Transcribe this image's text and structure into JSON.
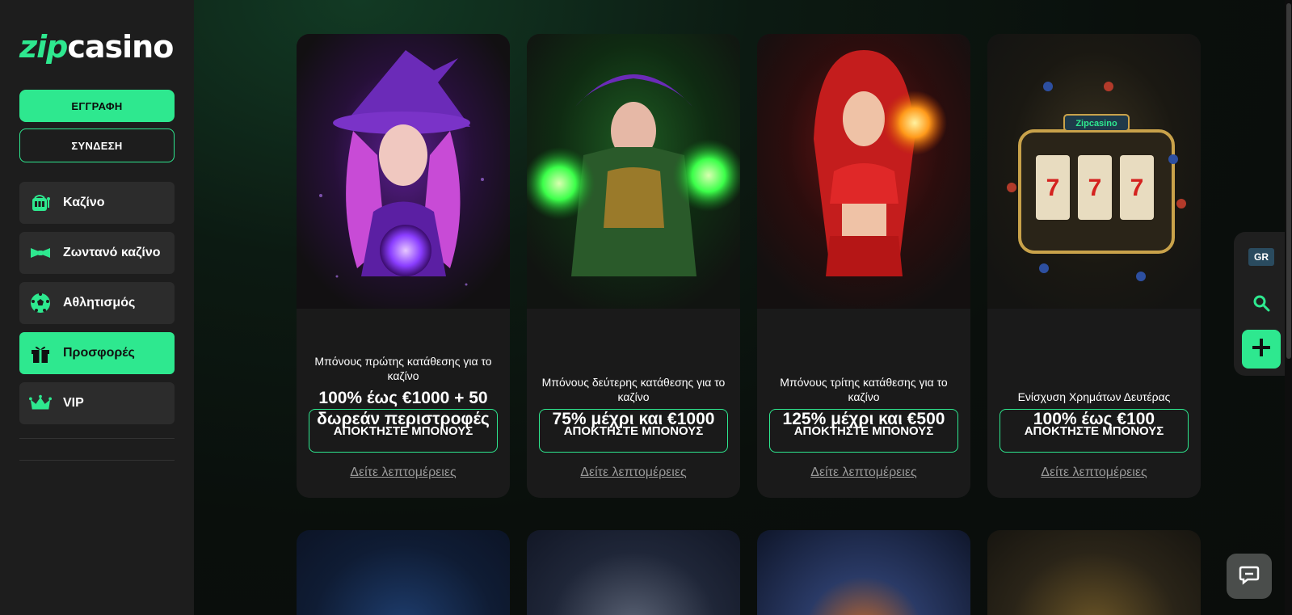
{
  "brand": {
    "part1": "zip",
    "part2": "casino",
    "accent": "#2ee88f"
  },
  "auth": {
    "register_label": "ΕΓΓΡΑΦΗ",
    "login_label": "ΣΥΝΔΕΣΗ"
  },
  "sidebar": {
    "items": [
      {
        "label": "Καζίνο",
        "icon": "slot-machine-icon",
        "active": false
      },
      {
        "label": "Ζωντανό καζίνο",
        "icon": "bowtie-icon",
        "active": false
      },
      {
        "label": "Αθλητισμός",
        "icon": "soccer-ball-icon",
        "active": false
      },
      {
        "label": "Προσφορές",
        "icon": "gift-icon",
        "active": true
      },
      {
        "label": "VIP",
        "icon": "crown-icon",
        "active": false
      }
    ]
  },
  "promos": [
    {
      "subtitle": "Μπόνους πρώτης κατάθεσης για το καζίνο",
      "headline": "100% έως €1000 + 50 δωρεάν περιστροφές",
      "cta": "ΑΠΟΚΤΗΣΤΕ ΜΠΟΝΟΥΣ",
      "details": "Δείτε λεπτομέρειες",
      "theme": "#7b2fd0"
    },
    {
      "subtitle": "Μπόνους δεύτερης κατάθεσης για το καζίνο",
      "headline": "75% μέχρι και €1000",
      "cta": "ΑΠΟΚΤΗΣΤΕ ΜΠΟΝΟΥΣ",
      "details": "Δείτε λεπτομέρειες",
      "theme": "#2ecc40"
    },
    {
      "subtitle": "Μπόνους τρίτης κατάθεσης για το καζίνο",
      "headline": "125% μέχρι και €500",
      "cta": "ΑΠΟΚΤΗΣΤΕ ΜΠΟΝΟΥΣ",
      "details": "Δείτε λεπτομέρειες",
      "theme": "#d62a2a"
    },
    {
      "subtitle": "Ενίσχυση Χρημάτων Δευτέρας",
      "headline": "100% έως €100",
      "cta": "ΑΠΟΚΤΗΣΤΕ ΜΠΟΝΟΥΣ",
      "details": "Δείτε λεπτομέρειες",
      "theme": "#c9a24a",
      "art_text": "Zipcasino"
    }
  ],
  "floating": {
    "language": "GR"
  }
}
